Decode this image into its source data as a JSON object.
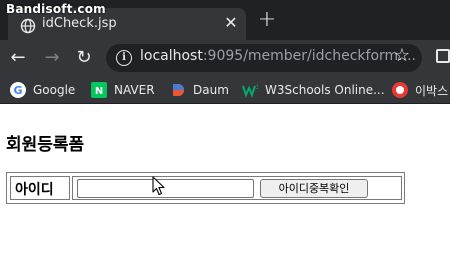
{
  "watermark": "Bandisoft.com",
  "browser": {
    "tab_title": "idCheck.jsp",
    "tab_close": "✕",
    "new_tab": "+",
    "url_host": "localhost",
    "url_rest": ":9095/member/idcheckform....",
    "back_glyph": "←",
    "forward_glyph": "→",
    "reload_glyph": "↻",
    "star_glyph": "☆",
    "info_glyph": "i"
  },
  "bookmarks": [
    {
      "label": "Google",
      "icon": "google-icon"
    },
    {
      "label": "NAVER",
      "icon": "naver-icon"
    },
    {
      "label": "Daum",
      "icon": "daum-icon"
    },
    {
      "label": "W3Schools Online...",
      "icon": "w3schools-icon"
    },
    {
      "label": "이박스",
      "icon": "ebox-icon"
    }
  ],
  "page": {
    "title": "회원등록폼",
    "id_label": "아이디",
    "id_input_value": "",
    "check_button": "아이디중복확인"
  },
  "colors": {
    "tabstrip": "#202124",
    "toolbar": "#35363a",
    "naver": "#03c75a",
    "w3schools": "#04aa6d"
  }
}
